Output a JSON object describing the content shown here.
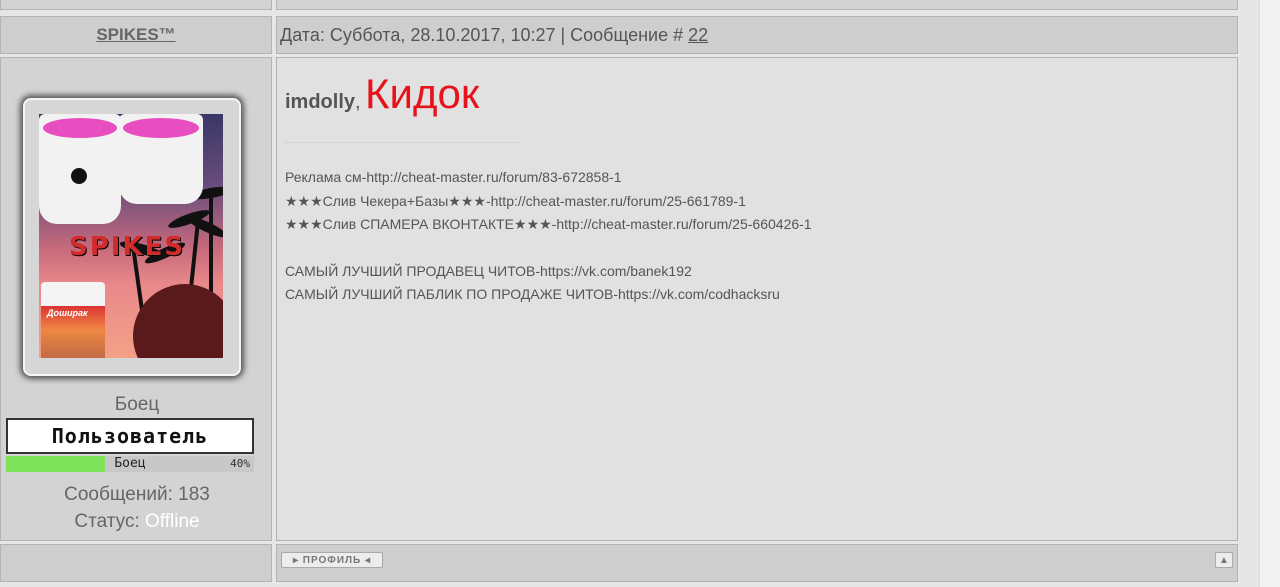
{
  "post": {
    "author": "SPIKES™",
    "header_text": "Дата: Суббота, 28.10.2017, 10:27 | Сообщение # ",
    "post_number": "22",
    "addressee": "imdolly",
    "separator": ",",
    "headline": "Кидок",
    "lines": [
      "Реклама см-http://cheat-master.ru/forum/83-672858-1",
      "★★★Слив Чекера+Базы★★★-http://cheat-master.ru/forum/25-661789-1",
      "★★★Слив СПАМЕРА ВКОНТАКТЕ★★★-http://cheat-master.ru/forum/25-660426-1",
      "САМЫЙ ЛУЧШИЙ ПРОДАВЕЦ ЧИТОВ-https://vk.com/banek192",
      "САМЫЙ ЛУЧШИЙ ПАБЛИК ПО ПРОДАЖЕ ЧИТОВ-https://vk.com/codhacksru"
    ]
  },
  "user": {
    "rank": "Боец",
    "group_badge": "Пользователь",
    "progress_label": "Боец",
    "progress_percent": "40%",
    "progress_value": 0.4,
    "messages_label": "Сообщений: 183",
    "status_label": "Статус: ",
    "status_value": "Offline",
    "avatar_text": "SPIKES",
    "avatar_noodle_label": "Доширак"
  },
  "footer": {
    "profile_button": "ПРОФИЛЬ",
    "top_icon": "scroll-top-icon"
  },
  "colors": {
    "headline": "#e8121b",
    "progress_fill": "#7fe35a",
    "status_offline": "#ffffff"
  }
}
